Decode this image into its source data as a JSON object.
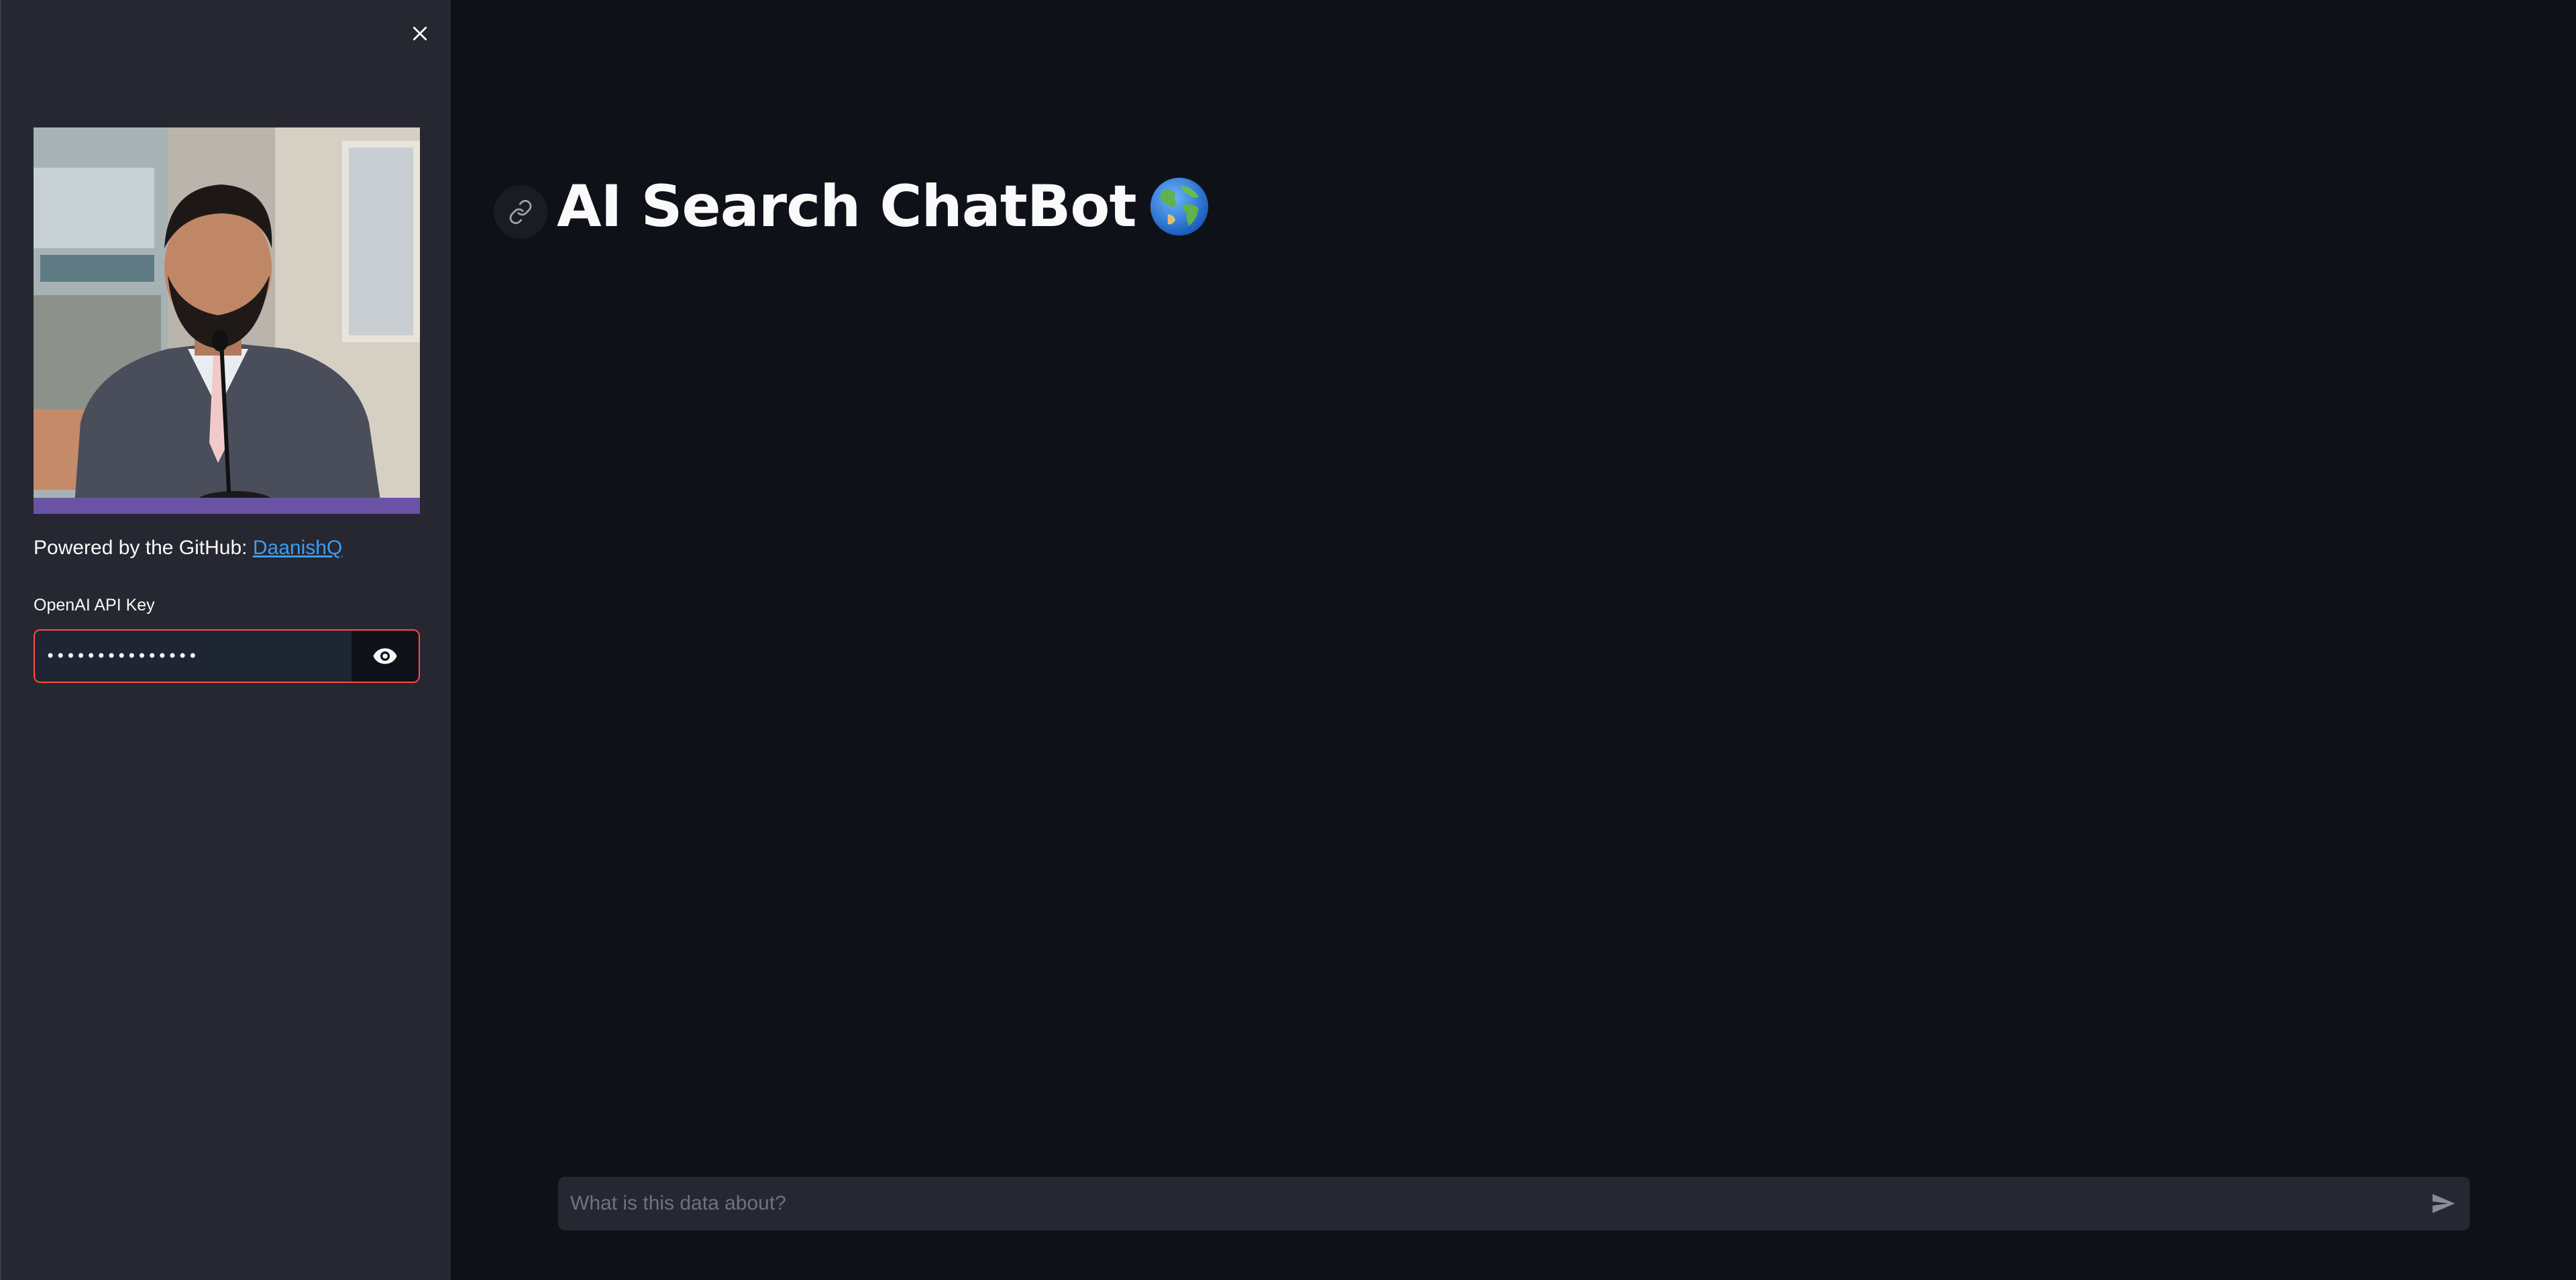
{
  "sidebar": {
    "powered_prefix": "Powered by the GitHub: ",
    "github_link": "DaanishQ",
    "api_key_label": "OpenAI API Key",
    "api_key_value": "•••••••••••••••"
  },
  "main": {
    "title": "AI Search ChatBot"
  },
  "chat": {
    "placeholder": "What is this data about?"
  },
  "icons": {
    "close": "close-icon",
    "eye": "eye-icon",
    "link": "link-icon",
    "globe": "globe-emoji-icon",
    "send": "send-icon"
  },
  "colors": {
    "background": "#0e1117",
    "sidebar": "#262730",
    "accent_error": "#ff4b4b",
    "link": "#3d9df3"
  }
}
